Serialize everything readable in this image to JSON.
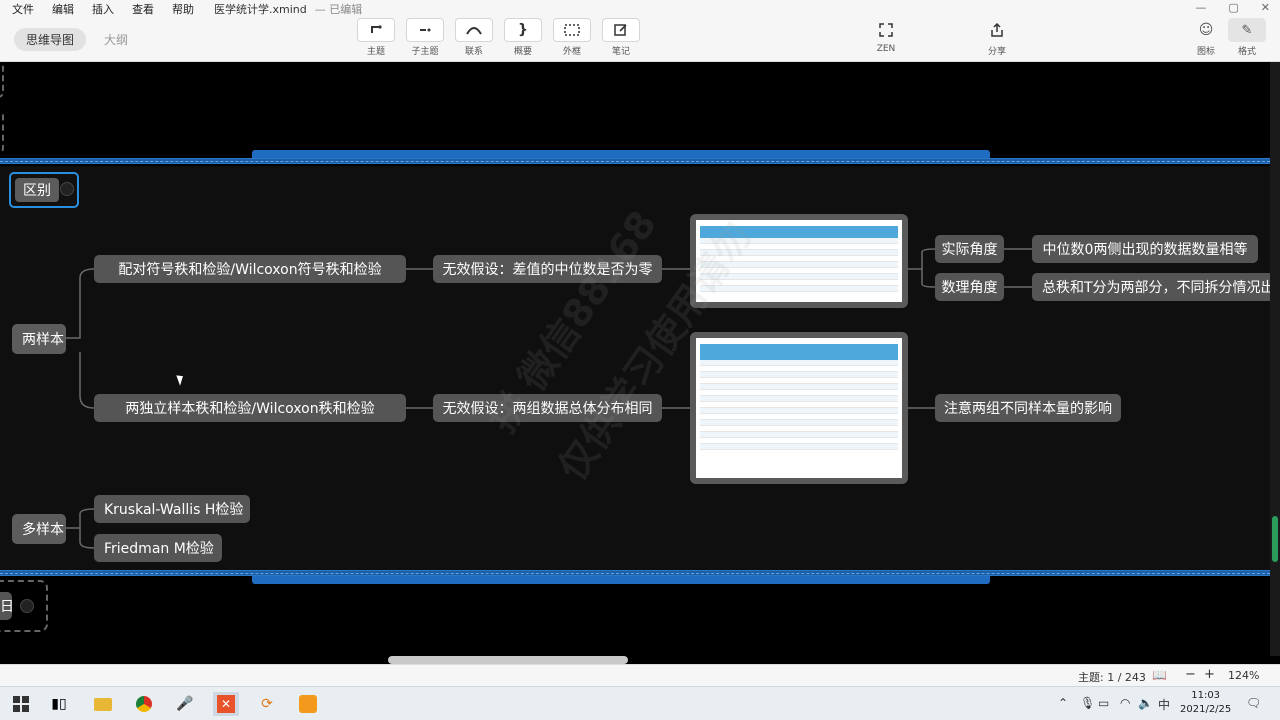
{
  "menu": {
    "items": [
      "文件",
      "编辑",
      "插入",
      "查看",
      "帮助"
    ],
    "doc_title": "医学统计学.xmind",
    "doc_status": "— 已编辑"
  },
  "view_switch": {
    "mindmap": "思维导图",
    "outline": "大纲"
  },
  "toolbar": {
    "topic": "主题",
    "subtopic": "子主题",
    "relation": "联系",
    "summary": "概要",
    "boundary": "外框",
    "note": "笔记",
    "zen": "ZEN",
    "share": "分享",
    "icon": "图标",
    "format": "格式"
  },
  "mindmap": {
    "distinction": "区别",
    "two_sample": "两样本",
    "multi_sample": "多样本",
    "paired_test": "配对符号秩和检验/Wilcoxon符号秩和检验",
    "paired_null": "无效假设：差值的中位数是否为零",
    "independent_test": "两独立样本秩和检验/Wilcoxon秩和检验",
    "independent_null": "无效假设：两组数据总体分布相同",
    "practical_angle": "实际角度",
    "practical_detail": "中位数0两侧出现的数据数量相等",
    "math_angle": "数理角度",
    "math_detail": "总秩和T分为两部分，不同拆分情况出",
    "sample_size_note": "注意两组不同样本量的影响",
    "kruskal": "Kruskal-Wallis H检验",
    "friedman": "Friedman M检验",
    "partial_left_node": "日"
  },
  "statusbar": {
    "topic_count": "主题: 1 / 243",
    "zoom": "124%"
  },
  "taskbar": {
    "time": "11:03",
    "date": "2021/2/25",
    "ime": "中"
  },
  "colors": {
    "accent_blue": "#1a5fa8",
    "node_gray": "#555555",
    "table_header": "#4fa8dc"
  }
}
